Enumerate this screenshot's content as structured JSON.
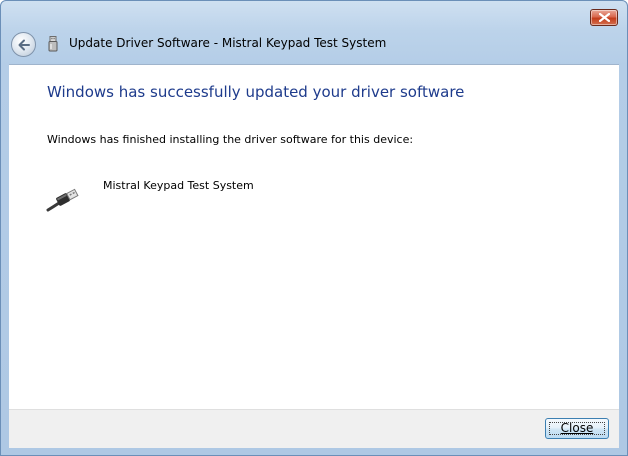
{
  "window": {
    "title": "Update Driver Software - Mistral Keypad Test System"
  },
  "content": {
    "headline": "Windows has successfully updated your driver software",
    "body": "Windows has finished installing the driver software for this device:",
    "device_name": "Mistral Keypad Test System"
  },
  "footer": {
    "close_label": "Close"
  },
  "icons": {
    "back": "back-arrow-icon",
    "close": "close-x-icon",
    "title": "usb-plug-icon",
    "device": "usb-cable-icon"
  },
  "colors": {
    "headline": "#1e3b8c",
    "close_button": "#c43d1c",
    "title_bar": "#bcd3ea"
  }
}
